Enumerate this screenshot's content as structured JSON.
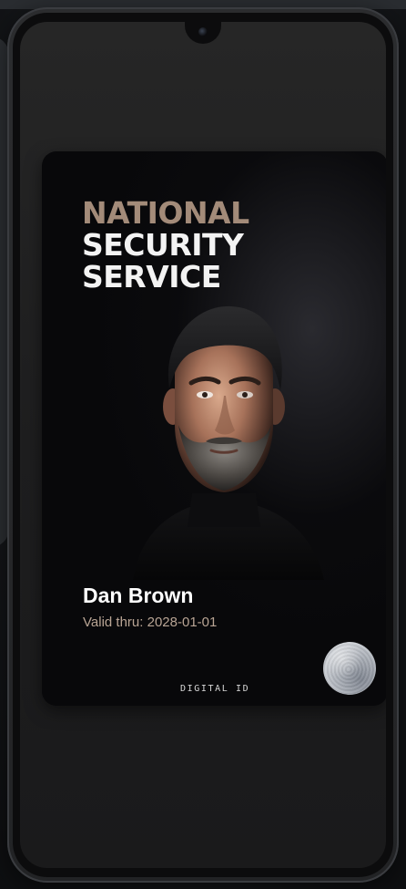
{
  "card": {
    "title_lines": [
      "NATIONAL",
      "SECURITY",
      "SERVICE"
    ],
    "holder_name": "Dan Brown",
    "valid_label": "Valid thru:",
    "valid_date": "2028-01-01",
    "footer_label": "DIGITAL ID"
  },
  "colors": {
    "title_accent": "#a38b79",
    "title_text": "#f3f3f3",
    "valid_text": "#b8a494",
    "card_background": "#08080a"
  },
  "icons": {
    "seal": "hologram-seal-icon",
    "camera": "front-camera-icon"
  }
}
